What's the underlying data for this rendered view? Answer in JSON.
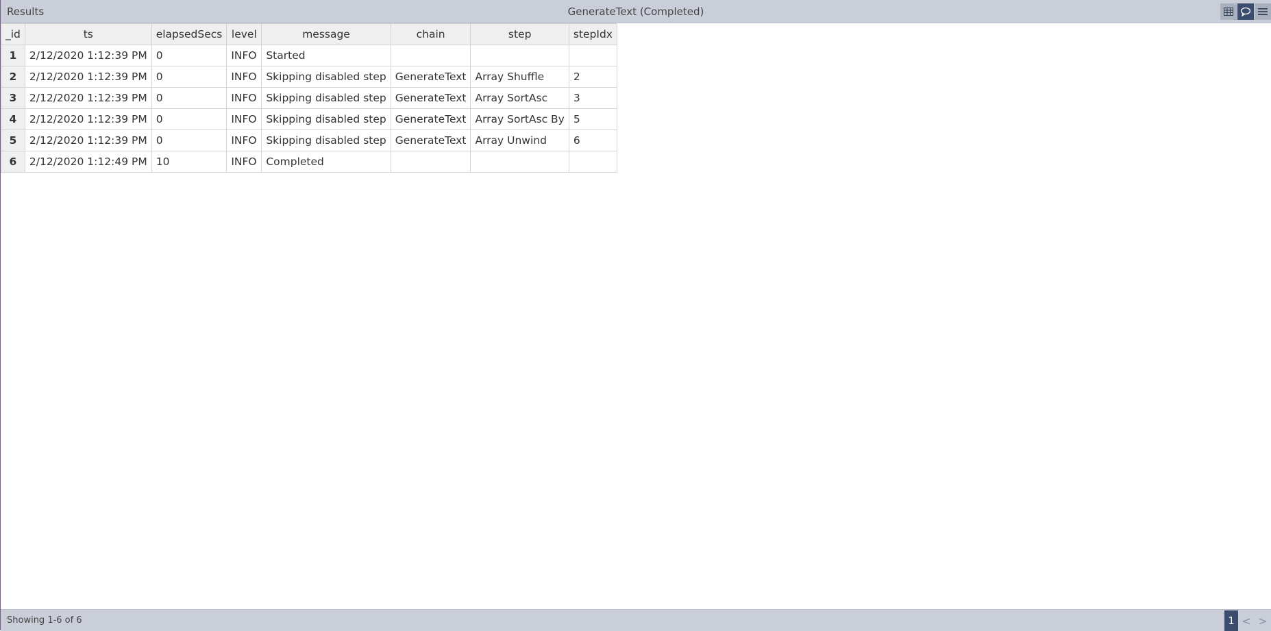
{
  "header": {
    "title": "Results",
    "subtitle": "GenerateText (Completed)"
  },
  "toolbar_icons": [
    "table-view-icon",
    "chat-bubble-icon",
    "menu-icon"
  ],
  "table": {
    "columns": [
      "_id",
      "ts",
      "elapsedSecs",
      "level",
      "message",
      "chain",
      "step",
      "stepIdx"
    ],
    "rows": [
      {
        "id": "1",
        "ts": "2/12/2020 1:12:39 PM",
        "elapsedSecs": "0",
        "level": "INFO",
        "message": "Started",
        "chain": "",
        "step": "",
        "stepIdx": ""
      },
      {
        "id": "2",
        "ts": "2/12/2020 1:12:39 PM",
        "elapsedSecs": "0",
        "level": "INFO",
        "message": "Skipping disabled step",
        "chain": "GenerateText",
        "step": "Array Shuffle",
        "stepIdx": "2"
      },
      {
        "id": "3",
        "ts": "2/12/2020 1:12:39 PM",
        "elapsedSecs": "0",
        "level": "INFO",
        "message": "Skipping disabled step",
        "chain": "GenerateText",
        "step": "Array SortAsc",
        "stepIdx": "3"
      },
      {
        "id": "4",
        "ts": "2/12/2020 1:12:39 PM",
        "elapsedSecs": "0",
        "level": "INFO",
        "message": "Skipping disabled step",
        "chain": "GenerateText",
        "step": "Array SortAsc By",
        "stepIdx": "5"
      },
      {
        "id": "5",
        "ts": "2/12/2020 1:12:39 PM",
        "elapsedSecs": "0",
        "level": "INFO",
        "message": "Skipping disabled step",
        "chain": "GenerateText",
        "step": "Array Unwind",
        "stepIdx": "6"
      },
      {
        "id": "6",
        "ts": "2/12/2020 1:12:49 PM",
        "elapsedSecs": "10",
        "level": "INFO",
        "message": "Completed",
        "chain": "",
        "step": "",
        "stepIdx": ""
      }
    ]
  },
  "footer": {
    "status": "Showing 1-6 of 6",
    "current_page": "1",
    "prev_label": "<",
    "next_label": ">"
  },
  "colors": {
    "bar_bg": "#c9ced8",
    "accent": "#3b4d6e",
    "header_cell": "#efefef"
  }
}
